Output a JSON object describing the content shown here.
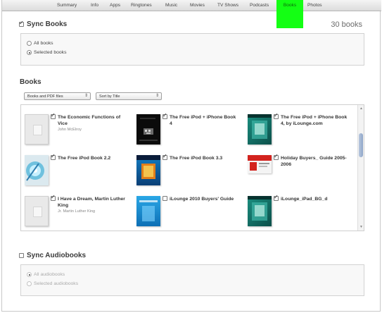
{
  "tabs": [
    {
      "label": "Summary"
    },
    {
      "label": "Info"
    },
    {
      "label": "Apps"
    },
    {
      "label": "Ringtones"
    },
    {
      "label": "Music"
    },
    {
      "label": "Movies"
    },
    {
      "label": "TV Shows"
    },
    {
      "label": "Podcasts"
    },
    {
      "label": "Books"
    },
    {
      "label": "Photos"
    }
  ],
  "active_tab": "Books",
  "accent_color": "#14ff14",
  "sync_books": {
    "label": "Sync Books",
    "checked": true,
    "count": "30 books",
    "options": [
      {
        "label": "All books",
        "selected": false
      },
      {
        "label": "Selected books",
        "selected": true
      }
    ]
  },
  "books": {
    "heading": "Books",
    "filter_select": "Books and PDF files",
    "sort_select": "Sort by Title",
    "items": [
      {
        "title": "The Economic Functions of Vice",
        "author": "John McElroy",
        "checked": true,
        "cover": "blank-cover"
      },
      {
        "title": "The Free iPod + iPhone Book 4",
        "author": "",
        "checked": true,
        "cover": "dark-cover"
      },
      {
        "title": "The Free iPod + iPhone Book 4, by iLounge.com",
        "author": "",
        "checked": true,
        "cover": "teal-cover"
      },
      {
        "title": "The Free iPod Book 2.2",
        "author": "",
        "checked": true,
        "cover": "cd-cover"
      },
      {
        "title": "The Free iPod Book 3.3",
        "author": "",
        "checked": true,
        "cover": "blue-cover"
      },
      {
        "title": "Holiday Buyers_ Guide 2005-2006",
        "author": "",
        "checked": true,
        "cover": "red-cover"
      },
      {
        "title": "I Have a Dream, Martin Luther King",
        "author": "Jr. Martin Luther King",
        "checked": true,
        "cover": "blank-cover"
      },
      {
        "title": "iLounge 2010 Buyers' Guide",
        "author": "",
        "checked": false,
        "cover": "light-blue-cover"
      },
      {
        "title": "iLounge_iPad_BG_d",
        "author": "",
        "checked": true,
        "cover": "teal-cover"
      }
    ]
  },
  "sync_audiobooks": {
    "label": "Sync Audiobooks",
    "checked": false,
    "options": [
      {
        "label": "All audiobooks",
        "selected": true
      },
      {
        "label": "Selected audiobooks",
        "selected": false
      }
    ]
  }
}
